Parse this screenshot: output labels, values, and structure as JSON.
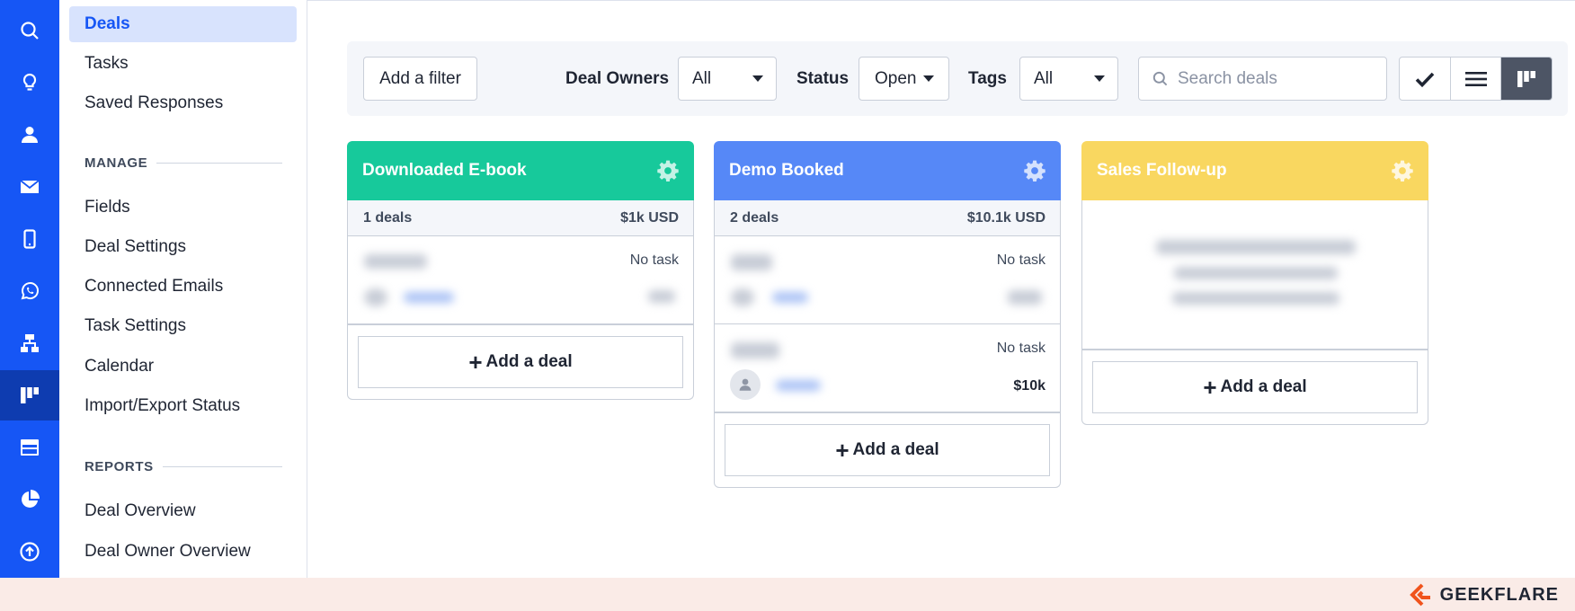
{
  "sidebar": {
    "items_top": [
      "Deals",
      "Tasks",
      "Saved Responses"
    ],
    "manage_heading": "MANAGE",
    "manage_items": [
      "Fields",
      "Deal Settings",
      "Connected Emails",
      "Task Settings",
      "Calendar",
      "Import/Export Status"
    ],
    "reports_heading": "REPORTS",
    "reports_items": [
      "Deal Overview",
      "Deal Owner Overview"
    ]
  },
  "toolbar": {
    "add_filter": "Add a filter",
    "deal_owners_label": "Deal Owners",
    "deal_owners_value": "All",
    "status_label": "Status",
    "status_value": "Open",
    "tags_label": "Tags",
    "tags_value": "All",
    "search_placeholder": "Search deals"
  },
  "columns": [
    {
      "title": "Downloaded E-book",
      "color": "#17c99b",
      "count": "1 deals",
      "total": "$1k USD",
      "deals": [
        {
          "task": "No task",
          "amount": ""
        }
      ],
      "add_label": "Add a deal"
    },
    {
      "title": "Demo Booked",
      "color": "#5688f7",
      "count": "2 deals",
      "total": "$10.1k USD",
      "deals": [
        {
          "task": "No task",
          "amount": ""
        },
        {
          "task": "No task",
          "amount": "$10k"
        }
      ],
      "add_label": "Add a deal"
    },
    {
      "title": "Sales Follow-up",
      "color": "#f9d760",
      "add_label": "Add a deal"
    }
  ],
  "footer": {
    "brand": "GEEKFLARE",
    "brand_color": "#f0531c"
  },
  "colors": {
    "rail": "#1656f5",
    "rail_active": "#0e3cb0",
    "nav_active_bg": "#d8e3fd"
  }
}
